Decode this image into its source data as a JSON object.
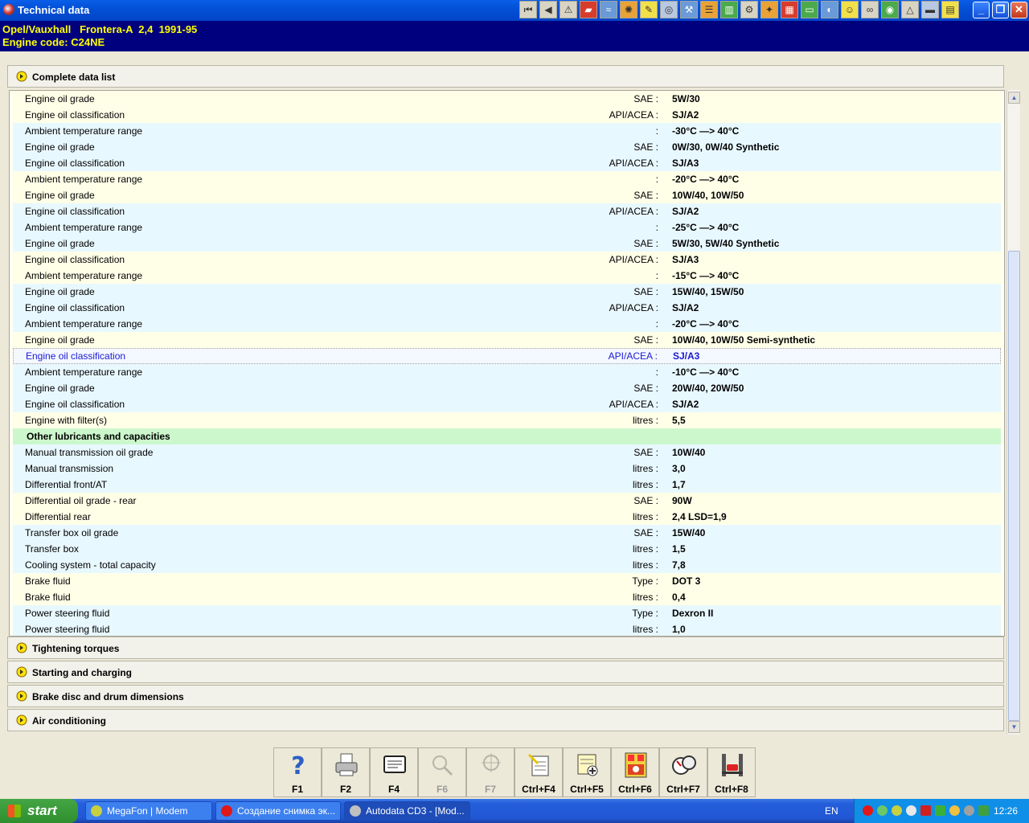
{
  "window": {
    "title": "Technical data"
  },
  "vehicle": {
    "line1": "Opel/Vauxhall   Frontera-A  2,4  1991-95",
    "line2": "Engine code: C24NE"
  },
  "sections": {
    "complete": "Complete data list",
    "torques": "Tightening torques",
    "starting": "Starting and charging",
    "brake": "Brake disc and drum dimensions",
    "aircon": "Air conditioning"
  },
  "rows": [
    {
      "label": "Engine oil grade",
      "unit": "SAE :",
      "value": "5W/30"
    },
    {
      "label": "Engine oil classification",
      "unit": "API/ACEA :",
      "value": "SJ/A2"
    },
    {
      "label": "Ambient temperature range",
      "unit": ":",
      "value": "-30°C —> 40°C"
    },
    {
      "label": "Engine oil grade",
      "unit": "SAE :",
      "value": "0W/30, 0W/40 Synthetic"
    },
    {
      "label": "Engine oil classification",
      "unit": "API/ACEA :",
      "value": "SJ/A3"
    },
    {
      "label": "Ambient temperature range",
      "unit": ":",
      "value": "-20°C —> 40°C"
    },
    {
      "label": "Engine oil grade",
      "unit": "SAE :",
      "value": "10W/40, 10W/50"
    },
    {
      "label": "Engine oil classification",
      "unit": "API/ACEA :",
      "value": "SJ/A2"
    },
    {
      "label": "Ambient temperature range",
      "unit": ":",
      "value": "-25°C —> 40°C"
    },
    {
      "label": "Engine oil grade",
      "unit": "SAE :",
      "value": "5W/30, 5W/40 Synthetic"
    },
    {
      "label": "Engine oil classification",
      "unit": "API/ACEA :",
      "value": "SJ/A3"
    },
    {
      "label": "Ambient temperature range",
      "unit": ":",
      "value": "-15°C —> 40°C"
    },
    {
      "label": "Engine oil grade",
      "unit": "SAE :",
      "value": "15W/40, 15W/50"
    },
    {
      "label": "Engine oil classification",
      "unit": "API/ACEA :",
      "value": "SJ/A2"
    },
    {
      "label": "Ambient temperature range",
      "unit": ":",
      "value": "-20°C —> 40°C"
    },
    {
      "label": "Engine oil grade",
      "unit": "SAE :",
      "value": "10W/40, 10W/50 Semi-synthetic"
    },
    {
      "label": "Engine oil classification",
      "unit": "API/ACEA :",
      "value": "SJ/A3"
    },
    {
      "label": "Ambient temperature range",
      "unit": ":",
      "value": "-10°C —> 40°C"
    },
    {
      "label": "Engine oil grade",
      "unit": "SAE :",
      "value": "20W/40, 20W/50"
    },
    {
      "label": "Engine oil classification",
      "unit": "API/ACEA :",
      "value": "SJ/A2"
    },
    {
      "label": "Engine with filter(s)",
      "unit": "litres :",
      "value": "5,5"
    },
    {
      "label": "Other lubricants and capacities",
      "unit": "",
      "value": ""
    },
    {
      "label": "Manual transmission oil grade",
      "unit": "SAE :",
      "value": "10W/40"
    },
    {
      "label": "Manual transmission",
      "unit": "litres :",
      "value": "3,0"
    },
    {
      "label": "Differential front/AT",
      "unit": "litres :",
      "value": "1,7"
    },
    {
      "label": "Differential oil grade - rear",
      "unit": "SAE :",
      "value": "90W"
    },
    {
      "label": "Differential rear",
      "unit": "litres :",
      "value": "2,4 LSD=1,9"
    },
    {
      "label": "Transfer box oil grade",
      "unit": "SAE :",
      "value": "15W/40"
    },
    {
      "label": "Transfer box",
      "unit": "litres :",
      "value": "1,5"
    },
    {
      "label": "Cooling system - total capacity",
      "unit": "litres :",
      "value": "7,8"
    },
    {
      "label": "Brake fluid",
      "unit": "Type :",
      "value": "DOT 3"
    },
    {
      "label": "Brake fluid",
      "unit": "litres :",
      "value": "0,4"
    },
    {
      "label": "Power steering fluid",
      "unit": "Type :",
      "value": "Dexron II"
    },
    {
      "label": "Power steering fluid",
      "unit": "litres :",
      "value": "1,0"
    }
  ],
  "fkeys": {
    "f1": "F1",
    "f2": "F2",
    "f4": "F4",
    "f6": "F6",
    "f7": "F7",
    "cf4": "Ctrl+F4",
    "cf5": "Ctrl+F5",
    "cf6": "Ctrl+F6",
    "cf7": "Ctrl+F7",
    "cf8": "Ctrl+F8"
  },
  "taskbar": {
    "start": "start",
    "task1": "MegaFon | Modem",
    "task2": "Создание снимка эк...",
    "task3": "Autodata CD3 - [Mod...",
    "lang": "EN",
    "clock": "12:26"
  },
  "colors": {
    "header_bg": "#00007f",
    "header_text": "#ffff00",
    "selected_text": "#1a1ad0",
    "subheader_bg": "#ccf7cc"
  }
}
